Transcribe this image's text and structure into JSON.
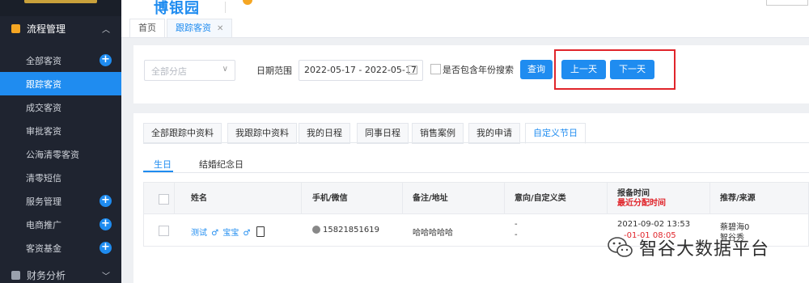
{
  "header": {
    "brand": "博银园"
  },
  "sidebar": {
    "group": {
      "label": "流程管理"
    },
    "items": [
      {
        "label": "全部客资",
        "has_add": true,
        "active": false
      },
      {
        "label": "跟踪客资",
        "has_add": false,
        "active": true
      },
      {
        "label": "成交客资",
        "has_add": false,
        "active": false
      },
      {
        "label": "审批客资",
        "has_add": false,
        "active": false
      },
      {
        "label": "公海清零客资",
        "has_add": false,
        "active": false
      },
      {
        "label": "清零短信",
        "has_add": false,
        "active": false
      },
      {
        "label": "服务管理",
        "has_add": true,
        "active": false
      },
      {
        "label": "电商推广",
        "has_add": true,
        "active": false
      },
      {
        "label": "客资基金",
        "has_add": true,
        "active": false
      }
    ],
    "bottom_group": {
      "label": "财务分析"
    }
  },
  "page_tabs": [
    {
      "label": "首页"
    },
    {
      "label": "跟踪客资",
      "close": "✕"
    }
  ],
  "filters": {
    "branch_placeholder": "全部分店",
    "date_label": "日期范围",
    "date_range": "2022-05-17 - 2022-05-17",
    "include_year_label": "是否包含年份搜索",
    "query_button": "查询",
    "prev_day_button": "上一天",
    "next_day_button": "下一天"
  },
  "record_tabs": [
    {
      "label": "全部跟踪中资料"
    },
    {
      "label": "我跟踪中资料"
    },
    {
      "label": "我的日程"
    },
    {
      "label": "同事日程"
    },
    {
      "label": "销售案例"
    },
    {
      "label": "我的申请"
    },
    {
      "label": "自定义节日"
    }
  ],
  "sub_tabs": [
    {
      "label": "生日"
    },
    {
      "label": "结婚纪念日"
    }
  ],
  "table": {
    "headers": {
      "name": "姓名",
      "phone": "手机/微信",
      "note": "备注/地址",
      "intent": "意向/自定义类",
      "report_time": "报备时间",
      "recent_assign": "最近分配时间",
      "referral": "推荐/来源"
    },
    "row": {
      "name1": "测试",
      "name2": "宝宝",
      "phone": "15821851619",
      "note": "哈哈哈哈哈",
      "intent1": "-",
      "intent2": "-",
      "report_time": "2021-09-02 13:53",
      "assign_time": "-01-01 08:05",
      "ref1": "蔡碧海0",
      "ref2": "智谷秀"
    }
  },
  "watermark": "智谷大数据平台",
  "colors": {
    "accent": "#1f8cf0",
    "sidebar_bg": "#1f2430",
    "highlight_red": "#e0252b"
  }
}
